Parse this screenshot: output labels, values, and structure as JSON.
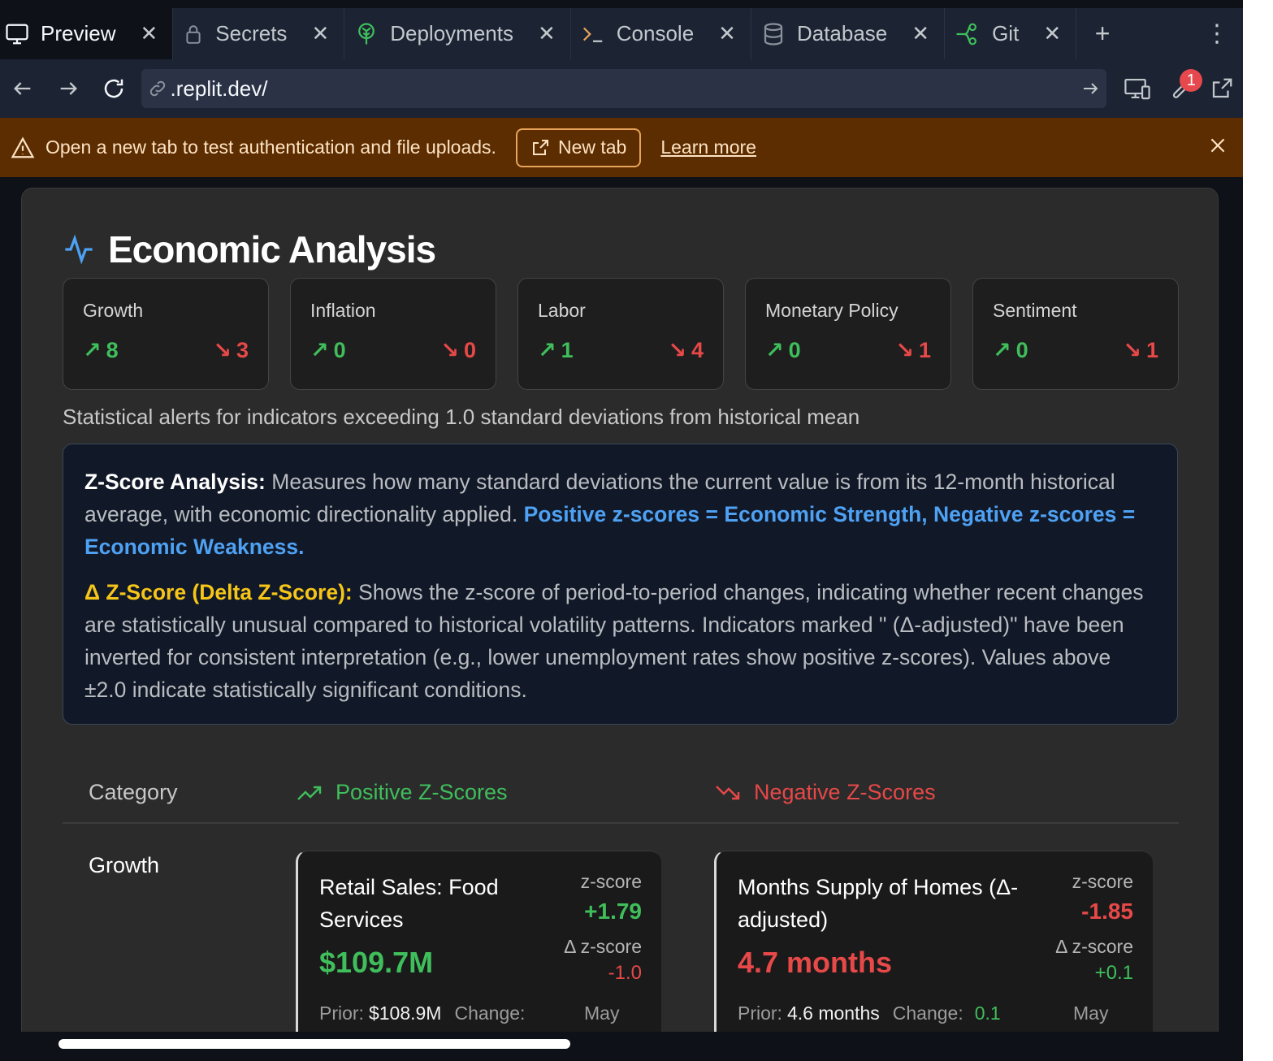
{
  "tabs": [
    {
      "label": "Preview",
      "icon": "monitor-icon",
      "active": true
    },
    {
      "label": "Secrets",
      "icon": "lock-icon"
    },
    {
      "label": "Deployments",
      "icon": "deploy-icon"
    },
    {
      "label": "Console",
      "icon": "terminal-icon"
    },
    {
      "label": "Database",
      "icon": "database-icon"
    },
    {
      "label": "Git",
      "icon": "git-icon"
    }
  ],
  "url": {
    "value": ".replit.dev/"
  },
  "devtools_badge": "1",
  "banner": {
    "text": "Open a new tab to test authentication and file uploads.",
    "button": "New tab",
    "link": "Learn more"
  },
  "page": {
    "title": "Economic Analysis",
    "categories": [
      {
        "name": "Growth",
        "up": "8",
        "down": "3"
      },
      {
        "name": "Inflation",
        "up": "0",
        "down": "0"
      },
      {
        "name": "Labor",
        "up": "1",
        "down": "4"
      },
      {
        "name": "Monetary Policy",
        "up": "0",
        "down": "1"
      },
      {
        "name": "Sentiment",
        "up": "0",
        "down": "1"
      }
    ],
    "description": "Statistical alerts for indicators exceeding 1.0 standard deviations from historical mean",
    "info": {
      "z_title": "Z-Score Analysis:",
      "z_text": "Measures how many standard deviations the current value is from its 12-month historical average, with economic directionality applied.",
      "z_highlight": "Positive z-scores = Economic Strength, Negative z-scores = Economic Weakness.",
      "dz_title": "Δ Z-Score (Delta Z-Score):",
      "dz_text": "Shows the z-score of period-to-period changes, indicating whether recent changes are statistically unusual compared to historical volatility patterns. Indicators marked \" (Δ-adjusted)\" have been inverted for consistent interpretation (e.g., lower unemployment rates show positive z-scores). Values above ±2.0 indicate statistically significant conditions."
    },
    "table": {
      "col_category": "Category",
      "col_positive": "Positive Z-Scores",
      "col_negative": "Negative Z-Scores",
      "row_category": "Growth",
      "positive": {
        "name": "Retail Sales: Food Services",
        "z_label": "z-score",
        "z": "+1.79",
        "dz_label": "Δ z-score",
        "dz": "-1.0",
        "value": "$109.7M",
        "prior_label": "Prior:",
        "prior": "$108.9M",
        "change_label": "Change:",
        "month": "May"
      },
      "negative": {
        "name": "Months Supply of Homes (Δ-adjusted)",
        "z_label": "z-score",
        "z": "-1.85",
        "dz_label": "Δ z-score",
        "dz": "+0.1",
        "value": "4.7 months",
        "prior_label": "Prior:",
        "prior": "4.6 months",
        "change_label": "Change:",
        "change": "0.1",
        "month": "May"
      }
    }
  },
  "colors": {
    "positive": "#3fbe5b",
    "negative": "#e74848",
    "accent_blue": "#4ea1f3",
    "accent_yellow": "#f5c518",
    "banner_bg": "#5c2d00"
  }
}
